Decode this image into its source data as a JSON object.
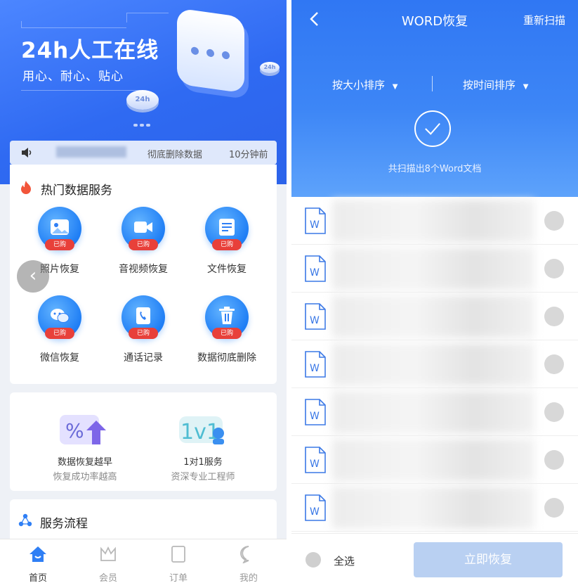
{
  "left": {
    "hero": {
      "title": "24h人工在线",
      "subtitle": "用心、耐心、贴心",
      "coin_label": "24h"
    },
    "notice": {
      "action": "彻底删除数据",
      "time": "10分钟前"
    },
    "hot_services": {
      "title": "热门数据服务",
      "badge": "已购",
      "items": [
        {
          "label": "照片恢复",
          "icon": "photo-icon"
        },
        {
          "label": "音视频恢复",
          "icon": "video-icon"
        },
        {
          "label": "文件恢复",
          "icon": "file-icon"
        },
        {
          "label": "微信恢复",
          "icon": "wechat-icon"
        },
        {
          "label": "通话记录",
          "icon": "phone-icon"
        },
        {
          "label": "数据彻底删除",
          "icon": "trash-icon"
        }
      ]
    },
    "promos": [
      {
        "line1": "数据恢复越早",
        "line2": "恢复成功率越高"
      },
      {
        "line1": "1对1服务",
        "line2": "资深专业工程师",
        "art_text": "1v1"
      }
    ],
    "flow": {
      "title": "服务流程"
    },
    "tabs": [
      {
        "label": "首页",
        "icon": "home-icon",
        "active": true
      },
      {
        "label": "会员",
        "icon": "crown-icon",
        "active": false
      },
      {
        "label": "订单",
        "icon": "order-icon",
        "active": false
      },
      {
        "label": "我的",
        "icon": "chat-icon",
        "active": false
      }
    ]
  },
  "right": {
    "header": {
      "title": "WORD恢复",
      "rescan": "重新扫描"
    },
    "sort": {
      "by_size": "按大小排序",
      "by_time": "按时间排序"
    },
    "scan_result": "共扫描出8个Word文档",
    "file_icon_letter": "W",
    "footer": {
      "select_all": "全选",
      "recover": "立即恢复"
    }
  },
  "colors": {
    "brand_blue": "#2f6af2",
    "badge_red": "#e8403a",
    "disabled_button": "#b9d0f2"
  }
}
